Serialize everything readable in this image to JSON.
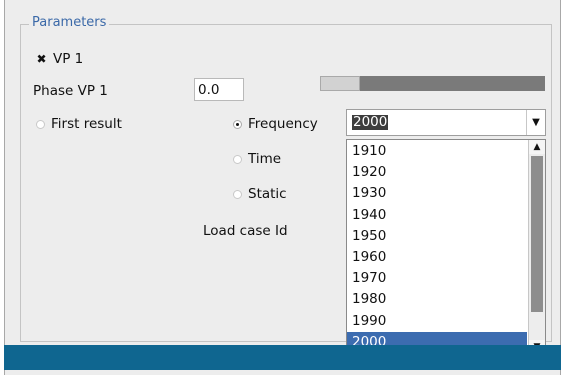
{
  "group": {
    "title": "Parameters"
  },
  "vp_checkbox": {
    "label": "VP 1",
    "mark": "✖",
    "checked": true
  },
  "phase": {
    "label": "Phase VP 1",
    "value": "0.0"
  },
  "slider": {
    "level": 0.12
  },
  "radios": {
    "first_result": {
      "label": "First result",
      "checked": false
    },
    "frequency": {
      "label": "Frequency",
      "checked": true
    },
    "time": {
      "label": "Time",
      "checked": false
    },
    "static": {
      "label": "Static",
      "checked": false
    }
  },
  "load_case": {
    "label": "Load case Id"
  },
  "combo": {
    "value": "2000",
    "arrow": "▼"
  },
  "dropdown": {
    "items": [
      "1910",
      "1920",
      "1930",
      "1940",
      "1950",
      "1960",
      "1970",
      "1980",
      "1990",
      "2000"
    ],
    "selected": "2000",
    "scroll_up": "▲",
    "scroll_down": "▼"
  },
  "colors": {
    "title_blue": "#3b69a8",
    "selection_blue": "#3c6cb0",
    "status_bar": "#0f6690"
  }
}
